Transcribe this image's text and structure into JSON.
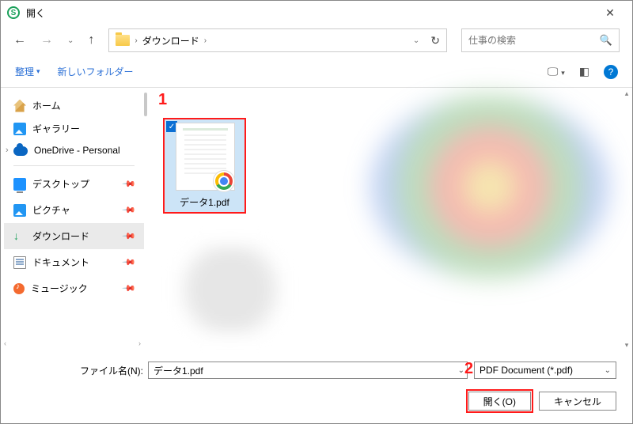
{
  "window": {
    "title": "開く"
  },
  "address": {
    "folder": "ダウンロード"
  },
  "search": {
    "placeholder": "仕事の検索"
  },
  "toolbar": {
    "organize": "整理",
    "new_folder": "新しいフォルダー"
  },
  "sidebar": {
    "home": "ホーム",
    "gallery": "ギャラリー",
    "onedrive": "OneDrive - Personal",
    "desktop": "デスクトップ",
    "pictures": "ピクチャ",
    "downloads": "ダウンロード",
    "documents": "ドキュメント",
    "music": "ミュージック"
  },
  "file": {
    "name": "データ1.pdf"
  },
  "footer": {
    "filename_label": "ファイル名(N):",
    "filename_value": "データ1.pdf",
    "filter": "PDF Document (*.pdf)",
    "open": "開く(O)",
    "cancel": "キャンセル"
  },
  "annotations": {
    "one": "1",
    "two": "2"
  }
}
